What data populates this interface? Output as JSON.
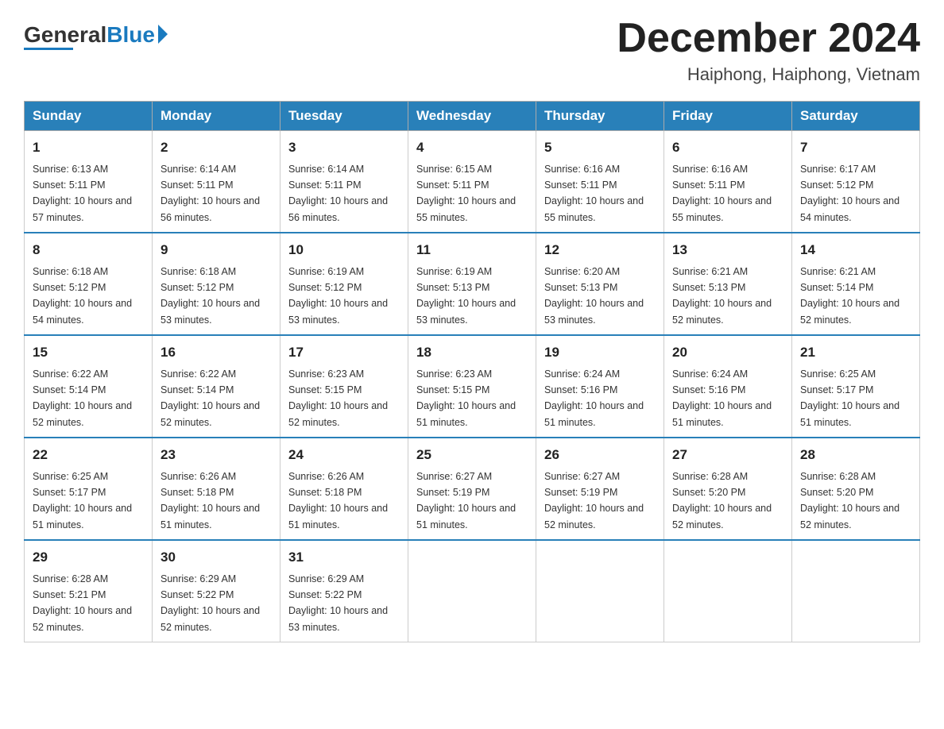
{
  "header": {
    "logo_general": "General",
    "logo_blue": "Blue",
    "month_year": "December 2024",
    "location": "Haiphong, Haiphong, Vietnam"
  },
  "weekdays": [
    "Sunday",
    "Monday",
    "Tuesday",
    "Wednesday",
    "Thursday",
    "Friday",
    "Saturday"
  ],
  "weeks": [
    [
      {
        "day": "1",
        "sunrise": "6:13 AM",
        "sunset": "5:11 PM",
        "daylight": "10 hours and 57 minutes."
      },
      {
        "day": "2",
        "sunrise": "6:14 AM",
        "sunset": "5:11 PM",
        "daylight": "10 hours and 56 minutes."
      },
      {
        "day": "3",
        "sunrise": "6:14 AM",
        "sunset": "5:11 PM",
        "daylight": "10 hours and 56 minutes."
      },
      {
        "day": "4",
        "sunrise": "6:15 AM",
        "sunset": "5:11 PM",
        "daylight": "10 hours and 55 minutes."
      },
      {
        "day": "5",
        "sunrise": "6:16 AM",
        "sunset": "5:11 PM",
        "daylight": "10 hours and 55 minutes."
      },
      {
        "day": "6",
        "sunrise": "6:16 AM",
        "sunset": "5:11 PM",
        "daylight": "10 hours and 55 minutes."
      },
      {
        "day": "7",
        "sunrise": "6:17 AM",
        "sunset": "5:12 PM",
        "daylight": "10 hours and 54 minutes."
      }
    ],
    [
      {
        "day": "8",
        "sunrise": "6:18 AM",
        "sunset": "5:12 PM",
        "daylight": "10 hours and 54 minutes."
      },
      {
        "day": "9",
        "sunrise": "6:18 AM",
        "sunset": "5:12 PM",
        "daylight": "10 hours and 53 minutes."
      },
      {
        "day": "10",
        "sunrise": "6:19 AM",
        "sunset": "5:12 PM",
        "daylight": "10 hours and 53 minutes."
      },
      {
        "day": "11",
        "sunrise": "6:19 AM",
        "sunset": "5:13 PM",
        "daylight": "10 hours and 53 minutes."
      },
      {
        "day": "12",
        "sunrise": "6:20 AM",
        "sunset": "5:13 PM",
        "daylight": "10 hours and 53 minutes."
      },
      {
        "day": "13",
        "sunrise": "6:21 AM",
        "sunset": "5:13 PM",
        "daylight": "10 hours and 52 minutes."
      },
      {
        "day": "14",
        "sunrise": "6:21 AM",
        "sunset": "5:14 PM",
        "daylight": "10 hours and 52 minutes."
      }
    ],
    [
      {
        "day": "15",
        "sunrise": "6:22 AM",
        "sunset": "5:14 PM",
        "daylight": "10 hours and 52 minutes."
      },
      {
        "day": "16",
        "sunrise": "6:22 AM",
        "sunset": "5:14 PM",
        "daylight": "10 hours and 52 minutes."
      },
      {
        "day": "17",
        "sunrise": "6:23 AM",
        "sunset": "5:15 PM",
        "daylight": "10 hours and 52 minutes."
      },
      {
        "day": "18",
        "sunrise": "6:23 AM",
        "sunset": "5:15 PM",
        "daylight": "10 hours and 51 minutes."
      },
      {
        "day": "19",
        "sunrise": "6:24 AM",
        "sunset": "5:16 PM",
        "daylight": "10 hours and 51 minutes."
      },
      {
        "day": "20",
        "sunrise": "6:24 AM",
        "sunset": "5:16 PM",
        "daylight": "10 hours and 51 minutes."
      },
      {
        "day": "21",
        "sunrise": "6:25 AM",
        "sunset": "5:17 PM",
        "daylight": "10 hours and 51 minutes."
      }
    ],
    [
      {
        "day": "22",
        "sunrise": "6:25 AM",
        "sunset": "5:17 PM",
        "daylight": "10 hours and 51 minutes."
      },
      {
        "day": "23",
        "sunrise": "6:26 AM",
        "sunset": "5:18 PM",
        "daylight": "10 hours and 51 minutes."
      },
      {
        "day": "24",
        "sunrise": "6:26 AM",
        "sunset": "5:18 PM",
        "daylight": "10 hours and 51 minutes."
      },
      {
        "day": "25",
        "sunrise": "6:27 AM",
        "sunset": "5:19 PM",
        "daylight": "10 hours and 51 minutes."
      },
      {
        "day": "26",
        "sunrise": "6:27 AM",
        "sunset": "5:19 PM",
        "daylight": "10 hours and 52 minutes."
      },
      {
        "day": "27",
        "sunrise": "6:28 AM",
        "sunset": "5:20 PM",
        "daylight": "10 hours and 52 minutes."
      },
      {
        "day": "28",
        "sunrise": "6:28 AM",
        "sunset": "5:20 PM",
        "daylight": "10 hours and 52 minutes."
      }
    ],
    [
      {
        "day": "29",
        "sunrise": "6:28 AM",
        "sunset": "5:21 PM",
        "daylight": "10 hours and 52 minutes."
      },
      {
        "day": "30",
        "sunrise": "6:29 AM",
        "sunset": "5:22 PM",
        "daylight": "10 hours and 52 minutes."
      },
      {
        "day": "31",
        "sunrise": "6:29 AM",
        "sunset": "5:22 PM",
        "daylight": "10 hours and 53 minutes."
      },
      null,
      null,
      null,
      null
    ]
  ]
}
